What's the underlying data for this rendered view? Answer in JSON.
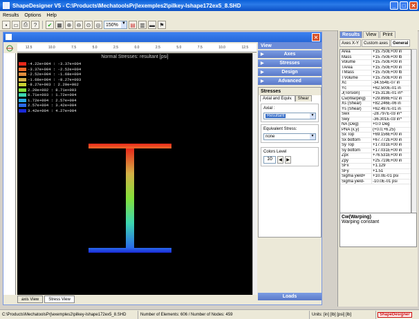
{
  "window": {
    "title": "ShapeDesigner  V5 - C:\\Products\\MechatoolsPrj\\exemples2\\pilkey-Ishape172ex5_8.SHD"
  },
  "menu": [
    "Results",
    "Options",
    "Help"
  ],
  "toolbar": {
    "zoom": "150%"
  },
  "ruler_top": [
    "12.5",
    "10.0",
    "7.5",
    "5.0",
    "2.5",
    "0.0",
    "2.5",
    "5.0",
    "7.5",
    "10.0",
    "12.5"
  ],
  "plot": {
    "title": "Normal Stresses: resultant [psi]",
    "legend": [
      {
        "range": "-4.22e+004 : -3.37e+004",
        "color": "#e8281a"
      },
      {
        "range": "-3.37e+004 : -2.52e+004",
        "color": "#ee6a2a"
      },
      {
        "range": "-2.52e+004 : -1.68e+004",
        "color": "#e08c3c"
      },
      {
        "range": "-1.68e+004 : -8.27e+003",
        "color": "#d4b046"
      },
      {
        "range": "-8.27e+003 : 2.20e+002",
        "color": "#c8d030"
      },
      {
        "range": "2.20e+002 : 8.71e+003",
        "color": "#84e03a"
      },
      {
        "range": "8.71e+003 : 1.72e+004",
        "color": "#3cd6b0"
      },
      {
        "range": "1.72e+004 : 2.57e+004",
        "color": "#2aa8e6"
      },
      {
        "range": "2.57e+004 : 3.42e+004",
        "color": "#2a6aea"
      },
      {
        "range": "3.42e+004 : 4.27e+004",
        "color": "#1a2ad8"
      }
    ]
  },
  "bottom_tabs": [
    "axis View",
    "Stress View"
  ],
  "view_panel": {
    "header": "View",
    "sections": [
      "Axes",
      "Stresses",
      "Design",
      "Advanced"
    ],
    "stresses_title": "Stresses",
    "tabs": [
      "Axial and Equiv.",
      "Shear"
    ],
    "axial_label": "Axial :",
    "axial_value": "Resultant",
    "equiv_label": "Equivalent Stress:",
    "equiv_value": "none",
    "colors_label": "Colors Level",
    "colors_value": "10",
    "loads": "Loads"
  },
  "results": {
    "tabs": [
      "Results",
      "View",
      "Print"
    ],
    "subtabs": [
      "Axes X-Y",
      "Custom axes",
      "General"
    ],
    "rows": [
      [
        "Area",
        "+15.750E+00 in"
      ],
      [
        "Mass",
        "+15.750E+00 lb"
      ],
      [
        "Volume",
        "+15.750E+00 in"
      ],
      [
        "TArea",
        "+15.750E+00 in"
      ],
      [
        "TMass",
        "+15.750E+00 lb"
      ],
      [
        "TVolume",
        "+15.750E+00 in"
      ],
      [
        "Xc",
        "-34.554E-07 in"
      ],
      [
        "Yc",
        "+62.500E-01 in"
      ],
      [
        "J(Torsion)",
        "+15.313E-01 in^"
      ],
      [
        "Cw(Warping)",
        "+29.898E+02 in"
      ],
      [
        "Xs (Shear)",
        "+82.246E-06 in"
      ],
      [
        "Ys (Shear)",
        "+62.497E-01 in"
      ],
      [
        "Swx",
        "-28.797E-03 in^"
      ],
      [
        "Swy",
        "-36.301E-03 in^"
      ],
      [
        "NA (Deg)",
        "+0.0 Deg"
      ],
      [
        "PNA (x,y)",
        "(+0.0,+6.25)"
      ],
      [
        "Sx Top",
        "+69.156E+00 in"
      ],
      [
        "Sx bottom",
        "+67.772E+00 in"
      ],
      [
        "Sy Top",
        "+17.031E+00 in"
      ],
      [
        "Sy bottom",
        "+17.031E+00 in"
      ],
      [
        "Zpx",
        "+76.531E+00 in"
      ],
      [
        "Zpy",
        "+25.719E+00 in"
      ],
      [
        "SFx",
        "+1.129"
      ],
      [
        "SFy",
        "+1.51"
      ],
      [
        "Sigma yield+",
        "+10.0E-01 psi"
      ],
      [
        "Sigma yield-",
        "-10.0E-01 psi"
      ]
    ],
    "desc_title": "Cw(Warping)",
    "desc_text": "Warping constant"
  },
  "status": {
    "path": "C:\\Products\\MechatoolsPrj\\exemples2\\pilkey-Ishape172ex5_8.SHD",
    "elements": "Number of Elements: 606 / Number of Nodes: 459",
    "units": "Units:  [in]  [lb]  [psi]  [lb]",
    "brand": "ShapeDesigner"
  }
}
